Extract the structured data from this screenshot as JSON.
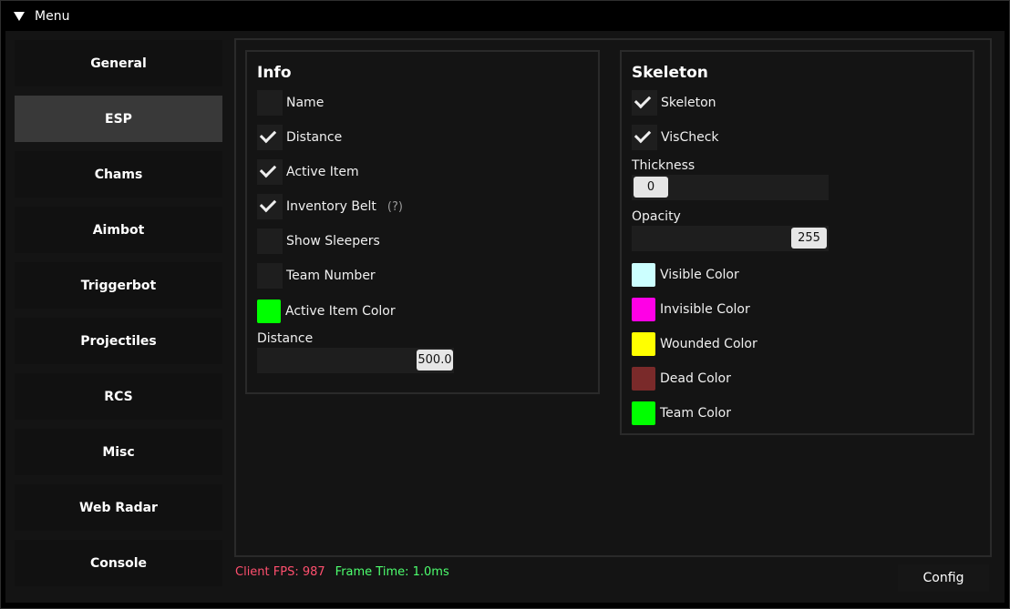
{
  "window": {
    "title": "Menu"
  },
  "sidebar": {
    "items": [
      {
        "label": "General"
      },
      {
        "label": "ESP",
        "active": true
      },
      {
        "label": "Chams"
      },
      {
        "label": "Aimbot"
      },
      {
        "label": "Triggerbot"
      },
      {
        "label": "Projectiles"
      },
      {
        "label": "RCS"
      },
      {
        "label": "Misc"
      },
      {
        "label": "Web Radar"
      },
      {
        "label": "Console"
      }
    ]
  },
  "info": {
    "title": "Info",
    "name": {
      "label": "Name",
      "checked": false
    },
    "distance": {
      "label": "Distance",
      "checked": true
    },
    "active_item": {
      "label": "Active Item",
      "checked": true
    },
    "inventory_belt": {
      "label": "Inventory Belt",
      "checked": true,
      "help": "(?)"
    },
    "show_sleepers": {
      "label": "Show Sleepers",
      "checked": false
    },
    "team_number": {
      "label": "Team Number",
      "checked": false
    },
    "active_item_color": {
      "label": "Active Item Color",
      "color": "#00ff00"
    },
    "distance_slider": {
      "label": "Distance",
      "value": "500.0"
    }
  },
  "skeleton": {
    "title": "Skeleton",
    "skeleton": {
      "label": "Skeleton",
      "checked": true
    },
    "vischeck": {
      "label": "VisCheck",
      "checked": true
    },
    "thickness": {
      "label": "Thickness",
      "value": "0"
    },
    "opacity": {
      "label": "Opacity",
      "value": "255"
    },
    "visible_color": {
      "label": "Visible Color",
      "color": "#ccffff"
    },
    "invisible_color": {
      "label": "Invisible Color",
      "color": "#ff00e6"
    },
    "wounded_color": {
      "label": "Wounded Color",
      "color": "#ffff00"
    },
    "dead_color": {
      "label": "Dead Color",
      "color": "#7a2a2a"
    },
    "team_color": {
      "label": "Team Color",
      "color": "#00ff00"
    }
  },
  "status": {
    "fps": "Client FPS: 987",
    "frame_time": "Frame Time: 1.0ms"
  },
  "config_button": {
    "label": "Config"
  }
}
